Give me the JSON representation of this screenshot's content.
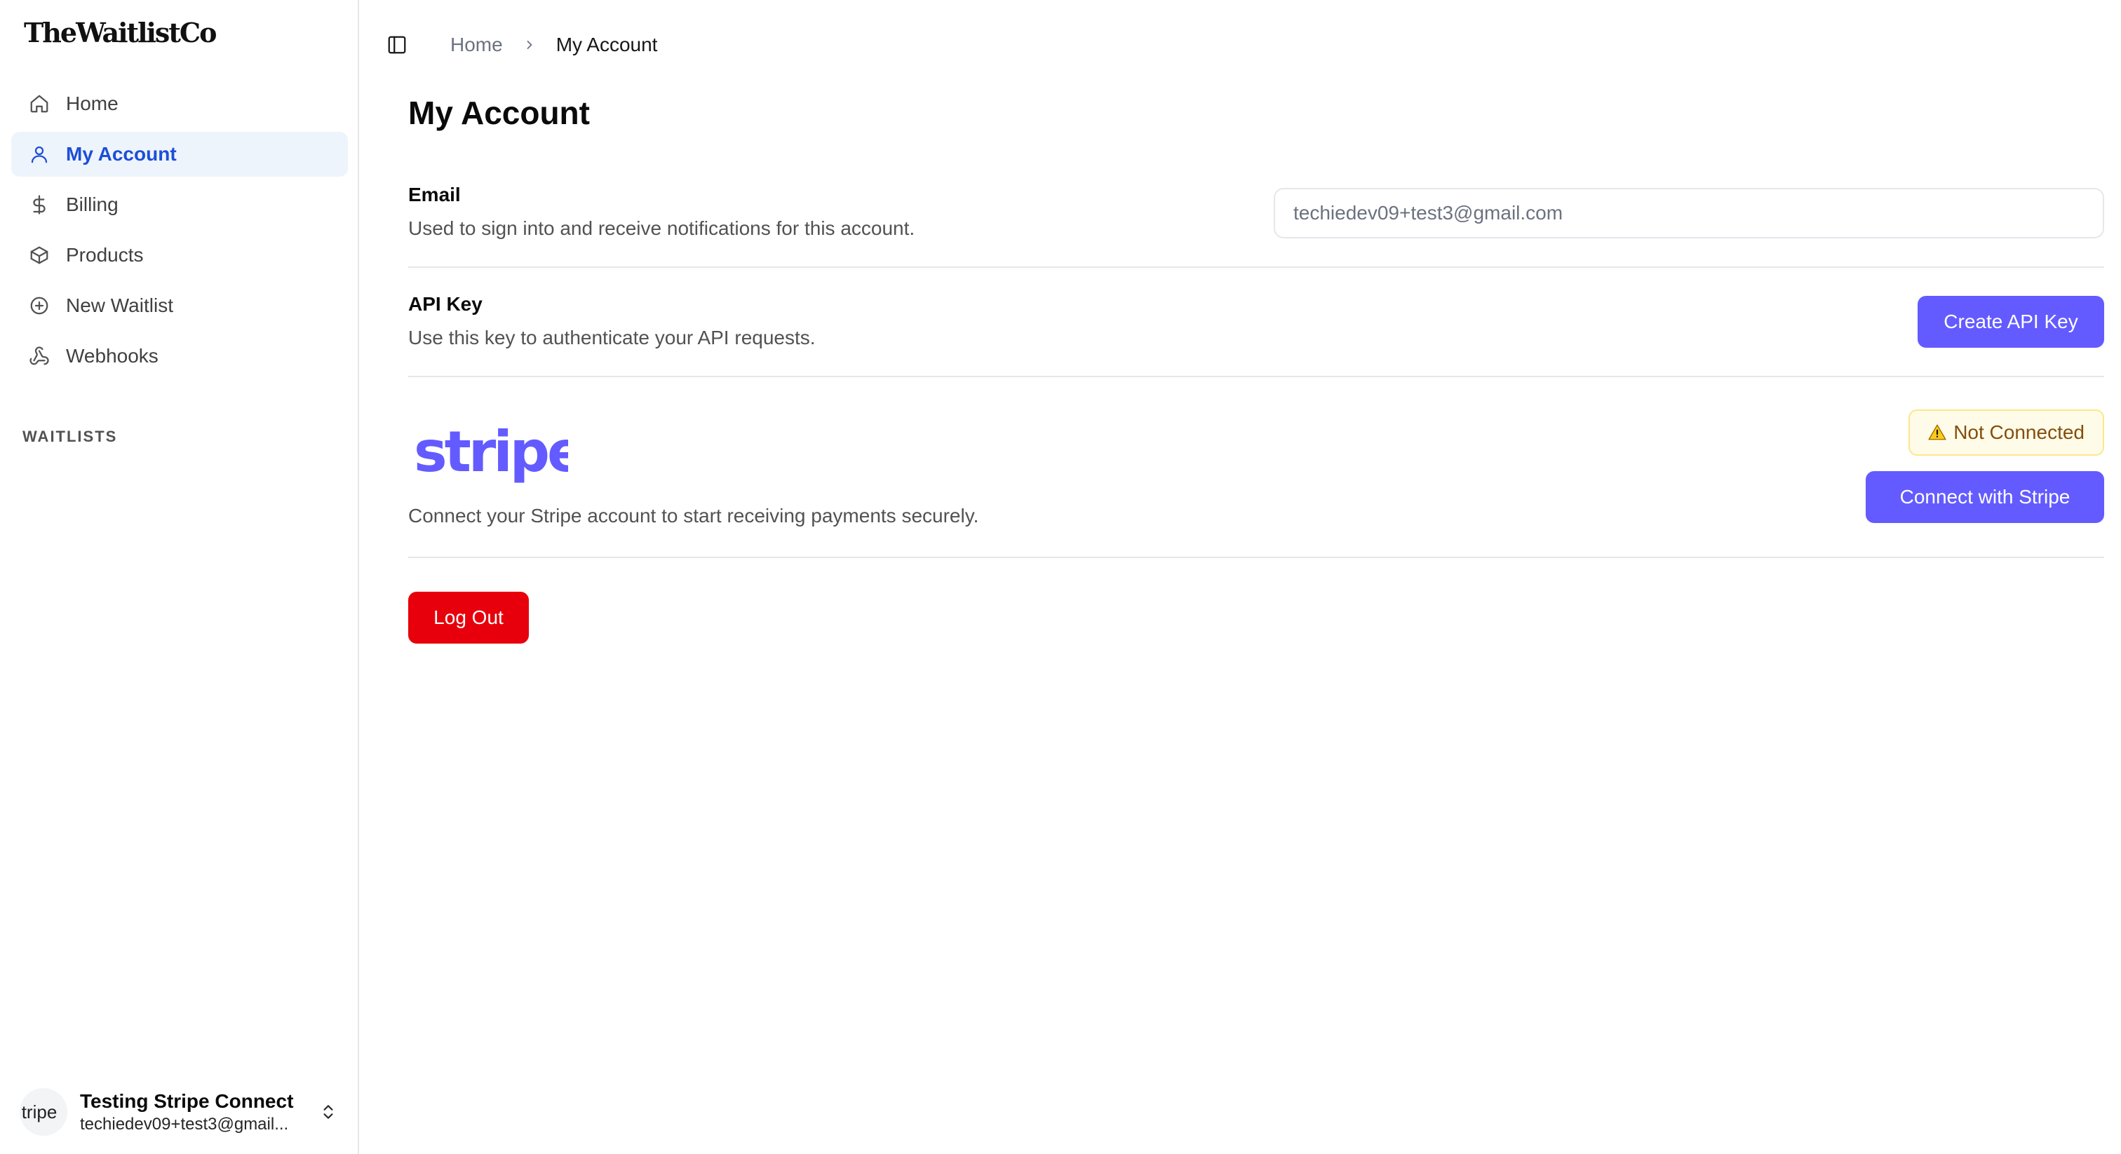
{
  "brand": {
    "name": "TheWaitlistCo"
  },
  "sidebar": {
    "items": [
      {
        "label": "Home",
        "icon": "home-icon",
        "active": false
      },
      {
        "label": "My Account",
        "icon": "user-icon",
        "active": true
      },
      {
        "label": "Billing",
        "icon": "dollar-icon",
        "active": false
      },
      {
        "label": "Products",
        "icon": "box-icon",
        "active": false
      },
      {
        "label": "New Waitlist",
        "icon": "plus-circle-icon",
        "active": false
      },
      {
        "label": "Webhooks",
        "icon": "webhook-icon",
        "active": false
      }
    ],
    "section_label": "WAITLISTS",
    "user": {
      "avatar_text": "tripe",
      "name": "Testing Stripe Connect",
      "email": "techiedev09+test3@gmail..."
    }
  },
  "breadcrumb": {
    "home": "Home",
    "current": "My Account"
  },
  "page": {
    "title": "My Account",
    "email": {
      "title": "Email",
      "desc": "Used to sign into and receive notifications for this account.",
      "value": "techiedev09+test3@gmail.com"
    },
    "api_key": {
      "title": "API Key",
      "desc": "Use this key to authenticate your API requests.",
      "button": "Create API Key"
    },
    "stripe": {
      "logo_text": "stripe",
      "desc": "Connect your Stripe account to start receiving payments securely.",
      "status": "Not Connected",
      "button": "Connect with Stripe"
    },
    "logout": "Log Out"
  },
  "colors": {
    "accent": "#635bff",
    "active_nav_bg": "#eef4fc",
    "active_nav_text": "#1d4ed8",
    "danger": "#e7000b",
    "warning_bg": "#fefce8",
    "stripe_logo": "#635bff"
  }
}
